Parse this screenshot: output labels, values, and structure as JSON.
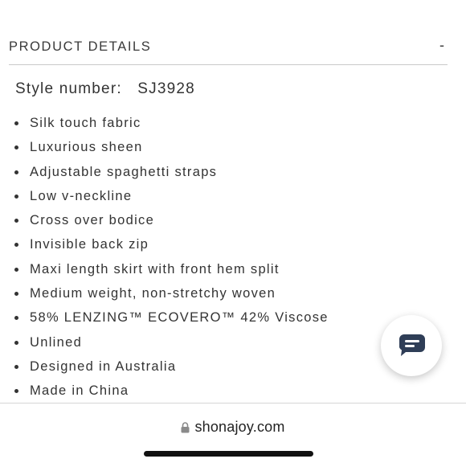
{
  "section": {
    "title": "PRODUCT DETAILS",
    "toggle_symbol": "-"
  },
  "style": {
    "label": "Style number:",
    "value": "SJ3928"
  },
  "features": [
    "Silk touch fabric",
    "Luxurious sheen",
    "Adjustable spaghetti straps",
    "Low v-neckline",
    "Cross over bodice",
    "Invisible back zip",
    "Maxi length skirt with front hem split",
    "Medium weight, non-stretchy woven",
    "58% LENZING™ ECOVERO™ 42% Viscose",
    "Unlined",
    "Designed in Australia",
    "Made in China"
  ],
  "chat": {
    "icon": "chat-bubble-icon",
    "accent": "#2f3e57"
  },
  "browser": {
    "url": "shonajoy.com",
    "lock_icon": "lock-icon"
  }
}
